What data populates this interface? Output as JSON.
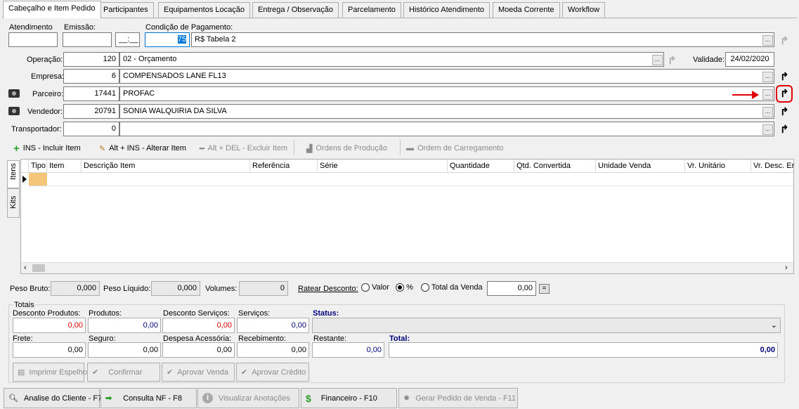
{
  "tabs": [
    "Cabeçalho e Item Pedido",
    "Participantes",
    "Equipamentos Locação",
    "Entrega / Observação",
    "Parcelamento",
    "Histórico Atendimento",
    "Moeda Corrente",
    "Workflow"
  ],
  "header": {
    "atendimento_label": "Atendimento",
    "emissao_label": "Emissão:",
    "emissao_time": "__:__",
    "condicao_label": "Condição de Pagamento:",
    "condicao_code": "75",
    "condicao_desc": "R$ Tabela 2",
    "operacao_label": "Operação:",
    "operacao_code": "120",
    "operacao_desc": "02 - Orçamento",
    "validade_label": "Validade:",
    "validade_value": "24/02/2020",
    "empresa_label": "Empresa:",
    "empresa_code": "6",
    "empresa_desc": "COMPENSADOS LANE FL13",
    "parceiro_label": "Parceiro:",
    "parceiro_code": "17441",
    "parceiro_desc": "PROFAC",
    "vendedor_label": "Vendedor:",
    "vendedor_code": "20791",
    "vendedor_desc": "SONIA WALQUIRIA DA SILVA",
    "transportador_label": "Transportador:",
    "transportador_code": "0",
    "transportador_desc": "",
    "lookup_dots": "..."
  },
  "toolbar": {
    "incluir": "INS - Incluir Item",
    "alterar": "Alt + INS - Alterar Item",
    "excluir": "Alt + DEL - Excluir Item",
    "ordens": "Ordens de Produção",
    "carregamento": "Ordem de Carregamento"
  },
  "side_tabs": [
    "Itens",
    "Kits"
  ],
  "grid_columns": [
    "Tipo",
    "Item",
    "Descrição Item",
    "Referência",
    "Série",
    "Quantidade",
    "Qtd. Convertida",
    "Unidade Venda",
    "Vr. Unitário",
    "Vr. Desc. Er"
  ],
  "weights": {
    "peso_bruto_label": "Peso Bruto:",
    "peso_bruto": "0,000",
    "peso_liquido_label": "Peso Líquido:",
    "peso_liquido": "0,000",
    "volumes_label": "Volumes:",
    "volumes": "0",
    "ratear_label": "Ratear Desconto:",
    "opt_valor": "Valor",
    "opt_pct": "%",
    "opt_total": "Total da Venda",
    "ratear_value": "0,00",
    "eq": "="
  },
  "totais": {
    "title": "Totais",
    "desconto_produtos_label": "Desconto Produtos:",
    "desconto_produtos": "0,00",
    "produtos_label": "Produtos:",
    "produtos": "0,00",
    "desconto_servicos_label": "Desconto Serviços:",
    "desconto_servicos": "0,00",
    "servicos_label": "Serviços:",
    "servicos": "0,00",
    "status_label": "Status:",
    "frete_label": "Frete:",
    "frete": "0,00",
    "seguro_label": "Seguro:",
    "seguro": "0,00",
    "despesa_label": "Despesa Acessória:",
    "despesa": "0,00",
    "recebimento_label": "Recebimento:",
    "recebimento": "0,00",
    "restante_label": "Restante:",
    "restante": "0,00",
    "total_label": "Total:",
    "total": "0,00"
  },
  "actions": {
    "imprimir": "Imprimir Espelho",
    "confirmar": "Confirmar",
    "aprovar_venda": "Aprovar Venda",
    "aprovar_credito": "Aprovar Crédito"
  },
  "bottom": {
    "analise": "Analise do Cliente - F7",
    "consulta": "Consulta NF - F8",
    "anotacoes": "Visualizar Anotações",
    "financeiro": "Financeiro - F10",
    "gerar": "Gerar Pedido de Venda - F11"
  },
  "colors": {
    "red_value": "#e00000",
    "blue_value": "#00007a",
    "annotation": "#e00000"
  }
}
